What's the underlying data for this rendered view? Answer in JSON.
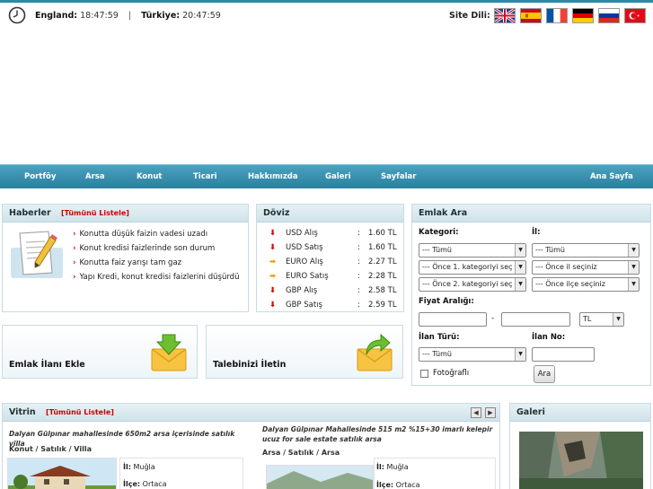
{
  "clock": {
    "icon": "clock-icon"
  },
  "times": {
    "england_label": "England:",
    "england_time": "18:47:59",
    "separator": "|",
    "turkiye_label": "Türkiye:",
    "turkiye_time": "20:47:59"
  },
  "language": {
    "label": "Site Dili:",
    "flags": [
      "uk-flag-icon",
      "spain-flag-icon",
      "france-flag-icon",
      "germany-flag-icon",
      "russia-flag-icon",
      "turkey-flag-icon"
    ]
  },
  "nav": {
    "items": [
      "Portföy",
      "Arsa",
      "Konut",
      "Ticari",
      "Hakkımızda",
      "Galeri",
      "Sayfalar"
    ],
    "home": "Ana Sayfa"
  },
  "news": {
    "title": "Haberler",
    "list_all": "[Tümünü Listele]",
    "items": [
      "Konutta düşük faizin vadesi uzadı",
      "Konut kredisi faizlerinde son durum",
      "Konutta faiz yarışı tam gaz",
      "Yapı Kredi, konut kredisi faizlerini düşürdü"
    ]
  },
  "doviz": {
    "title": "Döviz",
    "rows": [
      {
        "name": "USD Alış",
        "value": "1.60 TL",
        "trend": "down"
      },
      {
        "name": "USD Satış",
        "value": "1.60 TL",
        "trend": "down"
      },
      {
        "name": "EURO Alış",
        "value": "2.27 TL",
        "trend": "right"
      },
      {
        "name": "EURO Satış",
        "value": "2.28 TL",
        "trend": "right"
      },
      {
        "name": "GBP Alış",
        "value": "2.58 TL",
        "trend": "down"
      },
      {
        "name": "GBP Satış",
        "value": "2.59 TL",
        "trend": "down"
      }
    ],
    "colon": ":"
  },
  "search": {
    "title": "Emlak Ara",
    "kategori_label": "Kategori:",
    "il_label": "İl:",
    "kategori_value": "--- Tümü",
    "il_value": "--- Tümü",
    "kategori1_value": "--- Önce 1. kategoriyi seç",
    "il_secin_value": "--- Önce il seçiniz",
    "kategori2_value": "--- Önce 2. kategoriyi seç",
    "ilce_secin_value": "--- Önce ilçe seçiniz",
    "fiyat_label": "Fiyat Aralığı:",
    "dash": "-",
    "currency": "TL",
    "ilan_turu_label": "İlan Türü:",
    "ilan_no_label": "İlan No:",
    "ilan_turu_value": "--- Tümü",
    "foto_label": "Fotoğraflı",
    "search_button": "Ara"
  },
  "promos": {
    "add_listing": "Emlak İlanı Ekle",
    "send_request": "Talebinizi İletin"
  },
  "vitrin": {
    "title": "Vitrin",
    "list_all": "[Tümünü Listele]",
    "items": [
      {
        "title": "Dalyan Gülpınar mahallesinde 650m2 arsa içerisinde satılık villa",
        "category": "Konut / Satılık / Villa",
        "il_label": "İl:",
        "il": "Muğla",
        "ilce_label": "İlçe:",
        "ilce": "Ortaca"
      },
      {
        "title": "Dalyan Gülpınar Mahallesinde 515 m2 %15+30 imarlı kelepir ucuz for sale estate satılık arsa",
        "category": "Arsa / Satılık / Arsa",
        "il_label": "İl:",
        "il": "Muğla",
        "ilce_label": "İlçe:",
        "ilce": "Ortaca"
      }
    ]
  },
  "gallery": {
    "title": "Galeri"
  }
}
